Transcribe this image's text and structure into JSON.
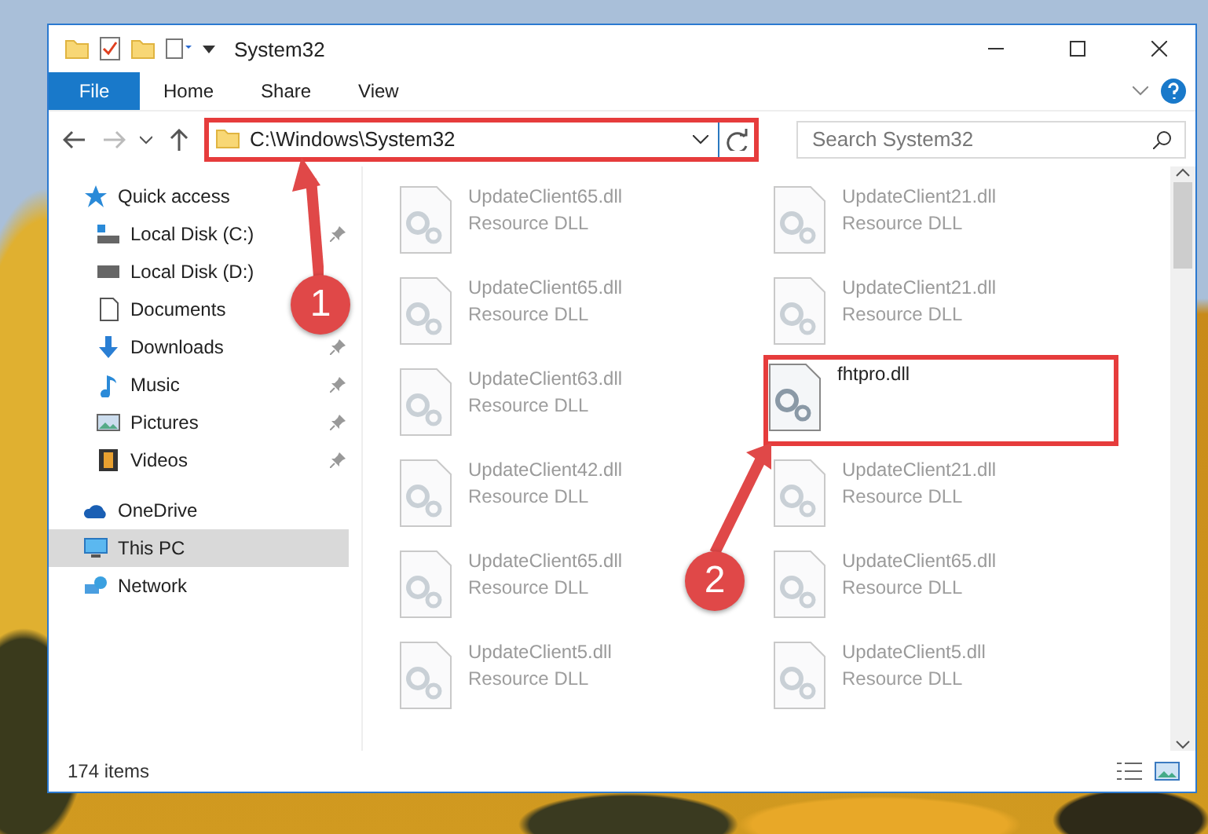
{
  "window": {
    "title": "System32"
  },
  "ribbon": {
    "file_button": "File",
    "tabs": [
      "Home",
      "Share",
      "View"
    ]
  },
  "address_bar": {
    "path": "C:\\Windows\\System32",
    "highlighted": true
  },
  "search": {
    "placeholder": "Search System32"
  },
  "sidebar": {
    "items": [
      {
        "label": "Quick access",
        "kind": "star",
        "selected": false,
        "children": [
          {
            "label": "Local Disk (C:)",
            "kind": "system-drive",
            "pinned": true,
            "selected": false
          },
          {
            "label": "Local Disk (D:)",
            "kind": "drive",
            "pinned": false,
            "selected": false
          },
          {
            "label": "Documents",
            "kind": "documents",
            "pinned": false,
            "selected": false
          },
          {
            "label": "Downloads",
            "kind": "downloads",
            "pinned": true,
            "selected": false
          },
          {
            "label": "Music",
            "kind": "music",
            "pinned": true,
            "selected": false
          },
          {
            "label": "Pictures",
            "kind": "pictures",
            "pinned": true,
            "selected": false
          },
          {
            "label": "Videos",
            "kind": "videos",
            "pinned": true,
            "selected": false
          }
        ]
      },
      {
        "label": "OneDrive",
        "kind": "cloud",
        "selected": false
      },
      {
        "label": "This PC",
        "kind": "computer",
        "selected": true
      },
      {
        "label": "Network",
        "kind": "network",
        "selected": false
      }
    ]
  },
  "files": [
    {
      "name": "UpdateClient65.dll",
      "type": "Resource DLL",
      "blurred": true,
      "highlighted": false
    },
    {
      "name": "UpdateClient21.dll",
      "type": "Resource DLL",
      "blurred": true,
      "highlighted": false
    },
    {
      "name": "UpdateClient65.dll",
      "type": "Resource DLL",
      "blurred": true,
      "highlighted": false
    },
    {
      "name": "UpdateClient21.dll",
      "type": "Resource DLL",
      "blurred": true,
      "highlighted": false
    },
    {
      "name": "UpdateClient63.dll",
      "type": "Resource DLL",
      "blurred": true,
      "highlighted": false
    },
    {
      "name": "fhtpro.dll",
      "blurred": false,
      "highlighted": true
    },
    {
      "name": "UpdateClient42.dll",
      "type": "Resource DLL",
      "blurred": true,
      "highlighted": false
    },
    {
      "name": "UpdateClient21.dll",
      "type": "Resource DLL",
      "blurred": true,
      "highlighted": false
    },
    {
      "name": "UpdateClient65.dll",
      "type": "Resource DLL",
      "blurred": true,
      "highlighted": false
    },
    {
      "name": "UpdateClient65.dll",
      "type": "Resource DLL",
      "blurred": true,
      "highlighted": false
    },
    {
      "name": "UpdateClient5.dll",
      "type": "Resource DLL",
      "blurred": true,
      "highlighted": false
    },
    {
      "name": "UpdateClient5.dll",
      "type": "Resource DLL",
      "blurred": true,
      "highlighted": false
    }
  ],
  "status_bar": {
    "item_count": "174 items"
  },
  "annotations": [
    {
      "number": "1"
    },
    {
      "number": "2"
    }
  ]
}
